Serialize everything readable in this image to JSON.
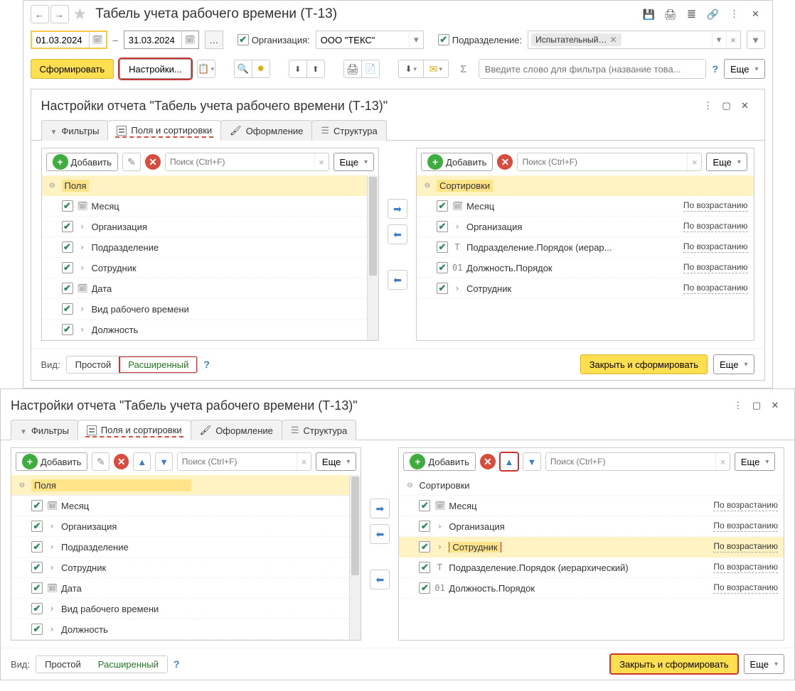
{
  "main": {
    "title": "Табель учета рабочего времени (Т-13)",
    "date_from": "01.03.2024",
    "date_to": "31.03.2024",
    "date_sep": "–",
    "org_label": "Организация:",
    "org_value": "ООО \"ТЕКС\"",
    "dept_label": "Подразделение:",
    "dept_tag": "Испытательный…",
    "btn_generate": "Сформировать",
    "btn_settings": "Настройки...",
    "search_placeholder": "Введите слово для фильтра (название това...",
    "btn_more": "Еще"
  },
  "dlg1": {
    "title": "Настройки отчета \"Табель учета рабочего времени (Т-13)\"",
    "tabs": {
      "filters": "Фильтры",
      "fields": "Поля и сортировки",
      "format": "Оформление",
      "structure": "Структура"
    },
    "btn_add": "Добавить",
    "search_placeholder": "Поиск (Ctrl+F)",
    "btn_more": "Еще",
    "fields_header": "Поля",
    "fields": [
      {
        "icon": "🗓",
        "label": "Месяц"
      },
      {
        "icon": "›",
        "label": "Организация"
      },
      {
        "icon": "›",
        "label": "Подразделение"
      },
      {
        "icon": "›",
        "label": "Сотрудник"
      },
      {
        "icon": "🗓",
        "label": "Дата"
      },
      {
        "icon": "›",
        "label": "Вид рабочего времени"
      },
      {
        "icon": "›",
        "label": "Должность"
      }
    ],
    "sort_header": "Сортировки",
    "sort_asc": "По возрастанию",
    "sorts": [
      {
        "icon": "🗓",
        "label": "Месяц"
      },
      {
        "icon": "›",
        "label": "Организация"
      },
      {
        "icon": "T",
        "label": "Подразделение.Порядок (иерар..."
      },
      {
        "icon": "01",
        "label": "Должность.Порядок"
      },
      {
        "icon": "›",
        "label": "Сотрудник"
      }
    ],
    "footer_view": "Вид:",
    "mode_simple": "Простой",
    "mode_ext": "Расширенный",
    "btn_close_gen": "Закрыть и сформировать"
  },
  "dlg2": {
    "title": "Настройки отчета \"Табель учета рабочего времени (Т-13)\"",
    "sorts": [
      {
        "icon": "🗓",
        "label": "Месяц",
        "hl": false
      },
      {
        "icon": "›",
        "label": "Организация",
        "hl": false
      },
      {
        "icon": "›",
        "label": "Сотрудник",
        "hl": true
      },
      {
        "icon": "T",
        "label": "Подразделение.Порядок (иерархический)",
        "hl": false
      },
      {
        "icon": "01",
        "label": "Должность.Порядок",
        "hl": false
      }
    ]
  }
}
